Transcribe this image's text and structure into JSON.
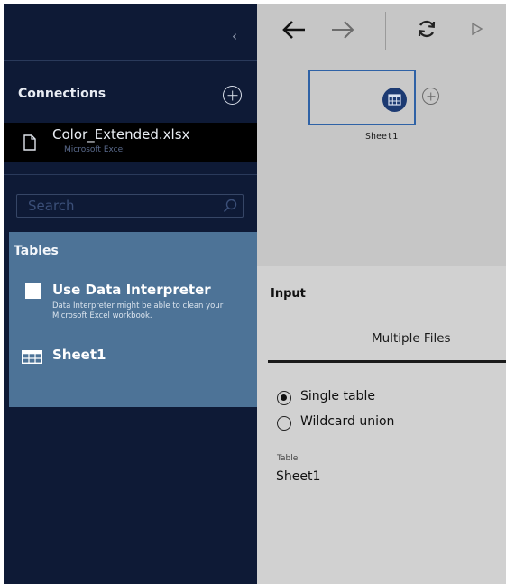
{
  "sidebar": {
    "collapse_glyph": "‹",
    "connections_title": "Connections",
    "connection": {
      "name": "Color_Extended.xlsx",
      "type": "Microsoft Excel"
    },
    "search": {
      "placeholder": "Search",
      "value": ""
    },
    "tables": {
      "title": "Tables",
      "interpreter_label": "Use Data Interpreter",
      "interpreter_desc": "Data Interpreter might be able to clean your Microsoft Excel workbook.",
      "interpreter_checked": false,
      "items": [
        {
          "label": "Sheet1",
          "icon": "table-icon"
        }
      ]
    }
  },
  "toolbar": {
    "icons": [
      "back-arrow-icon",
      "forward-arrow-icon",
      "refresh-icon",
      "run-icon"
    ]
  },
  "flow": {
    "node_label": "Sheet1",
    "node_icon": "table-icon"
  },
  "input_panel": {
    "title": "Input",
    "tab_label": "Multiple Files",
    "options": [
      {
        "label": "Single table",
        "checked": true
      },
      {
        "label": "Wildcard union",
        "checked": false
      }
    ],
    "table_caption": "Table",
    "table_value": "Sheet1"
  },
  "colors": {
    "sidebar_bg": "#0e1a36",
    "tables_panel_bg": "#4d7397",
    "canvas_bg": "#c6c6c6",
    "panel_bg": "#d1d1d1",
    "node_border": "#2f62a6",
    "node_icon_bg": "#1c3a72"
  }
}
